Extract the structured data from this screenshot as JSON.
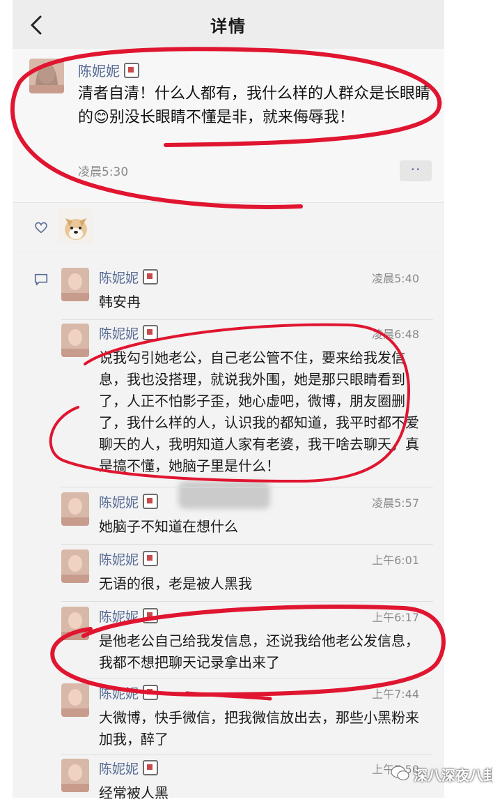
{
  "header": {
    "title": "详情",
    "back_icon": "chevron-left-icon"
  },
  "post": {
    "author": "陈妮妮",
    "text": "清者自清！什么人都有，我什么样的人群众是长眼睛的😊别没长眼睛不懂是非，就来侮辱我！",
    "time": "凌晨5:30",
    "more_label": "··"
  },
  "likes": {
    "icon": "heart-outline-icon"
  },
  "comments": [
    {
      "name": "陈妮妮",
      "time": "凌晨5:40",
      "text": "韩安冉"
    },
    {
      "name": "陈妮妮",
      "time": "凌晨6:48",
      "text": "说我勾引她老公，自己老公管不住，要来给我发信息，我也没搭理，就说我外围，她是那只眼睛看到了，人正不怕影子歪，她心虚吧，微博，朋友圈删了，我什么样的人，认识我的都知道，我平时都不爱聊天的人，我明知道人家有老婆，我干啥去聊天，真是搞不懂，她脑子里是什么！"
    },
    {
      "name": "陈妮妮",
      "time": "凌晨5:57",
      "text": "她脑子不知道在想什么"
    },
    {
      "name": "陈妮妮",
      "time": "上午6:01",
      "text": "无语的很，老是被人黑我"
    },
    {
      "name": "陈妮妮",
      "time": "上午6:17",
      "text": "是他老公自己给我发信息，还说我给他老公发信息，我都不想把聊天记录拿出来了"
    },
    {
      "name": "陈妮妮",
      "time": "上午7:44",
      "text": "大微博，快手微信，把我微信放出去，那些小黑粉来加我，醉了"
    },
    {
      "name": "陈妮妮",
      "time": "上午7:50",
      "text": "经常被人黑"
    }
  ],
  "watermark": {
    "text": "深八深夜八卦"
  },
  "colors": {
    "name_blue": "#576b95",
    "annotation_red": "#e01530",
    "bg": "#ededed"
  }
}
